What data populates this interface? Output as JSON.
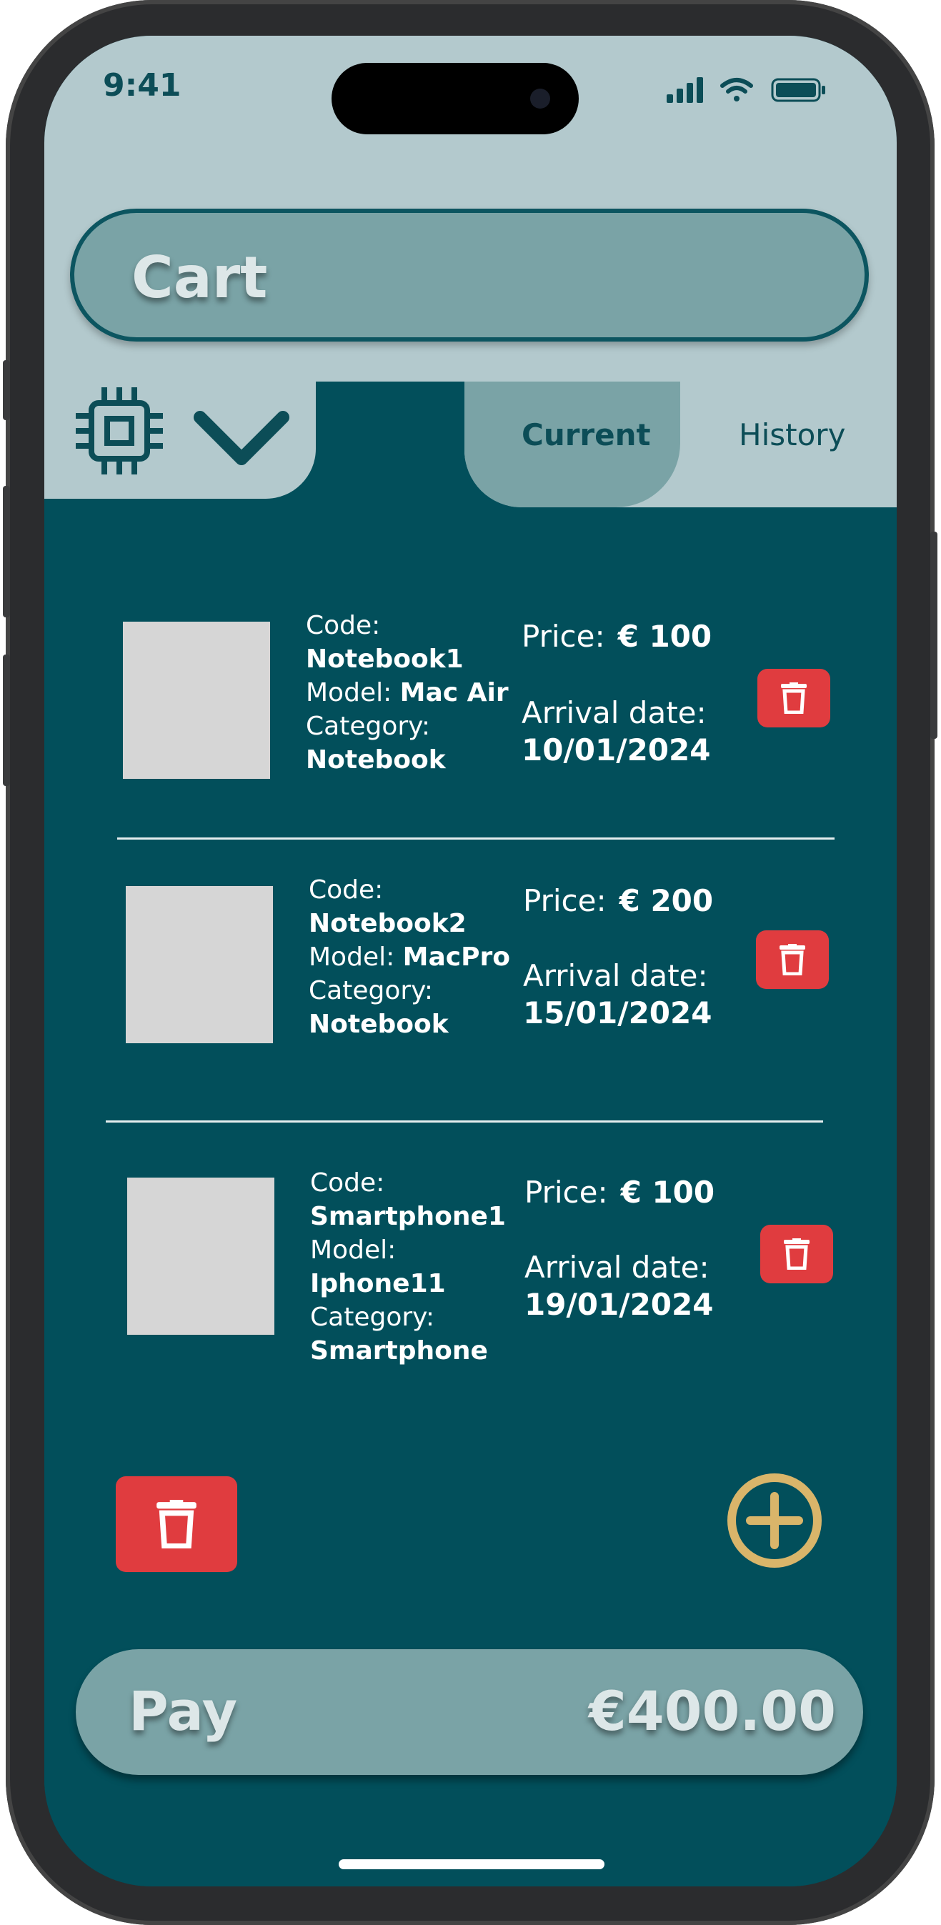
{
  "status": {
    "time": "9:41"
  },
  "header": {
    "title": "Cart"
  },
  "tabs": [
    {
      "label": "Current",
      "active": true
    },
    {
      "label": "History",
      "active": false
    }
  ],
  "items": [
    {
      "code_label": "Code:",
      "code": "Notebook1",
      "model_label": "Model: ",
      "model": "Mac Air",
      "category_label": "Category:",
      "category": "Notebook",
      "price_label": "Price:",
      "price": "€ 100",
      "arrival_label": "Arrival date:",
      "arrival": "10/01/2024"
    },
    {
      "code_label": "Code:",
      "code": "Notebook2",
      "model_label": "Model: ",
      "model": "MacPro",
      "category_label": "Category:",
      "category": "Notebook",
      "price_label": "Price:",
      "price": "€ 200",
      "arrival_label": "Arrival date:",
      "arrival": "15/01/2024"
    },
    {
      "code_label": "Code:",
      "code": "Smartphone1",
      "model_label": "Model:",
      "model": "Iphone11",
      "category_label": "Category:",
      "category": "Smartphone",
      "price_label": "Price:",
      "price": "€ 100",
      "arrival_label": "Arrival date:",
      "arrival": "19/01/2024"
    }
  ],
  "footer": {
    "pay_label": "Pay",
    "total": "€400.00"
  },
  "colors": {
    "background": "#024f5b",
    "header_bg": "#b3c9cd",
    "accent": "#7aa3a6",
    "delete": "#e03c3f",
    "add": "#d9b56a"
  },
  "icons": {
    "menu_icon": "chip-icon",
    "dropdown": "chevron-down-icon",
    "delete": "trash-icon",
    "add": "plus-circle-icon"
  }
}
